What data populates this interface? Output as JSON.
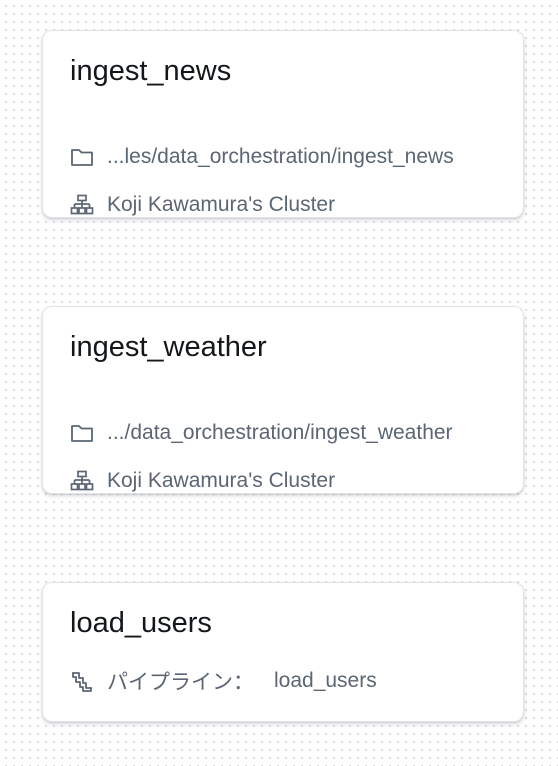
{
  "cards": [
    {
      "title": "ingest_news",
      "path": "...les/data_orchestration/ingest_news",
      "cluster": "Koji Kawamura's Cluster",
      "path_icon": "folder-icon",
      "cluster_icon": "cluster-icon"
    },
    {
      "title": "ingest_weather",
      "path": ".../data_orchestration/ingest_weather",
      "cluster": "Koji Kawamura's Cluster",
      "path_icon": "folder-icon",
      "cluster_icon": "cluster-icon"
    },
    {
      "title": "load_users",
      "pipeline_label": "パイプライン：",
      "pipeline_value": "load_users",
      "pipeline_icon": "pipeline-icon"
    }
  ],
  "colors": {
    "title": "#14171a",
    "secondary_text": "#5b6674",
    "card_border": "#e1e4e8",
    "dot_grid": "#d5d8dd"
  }
}
